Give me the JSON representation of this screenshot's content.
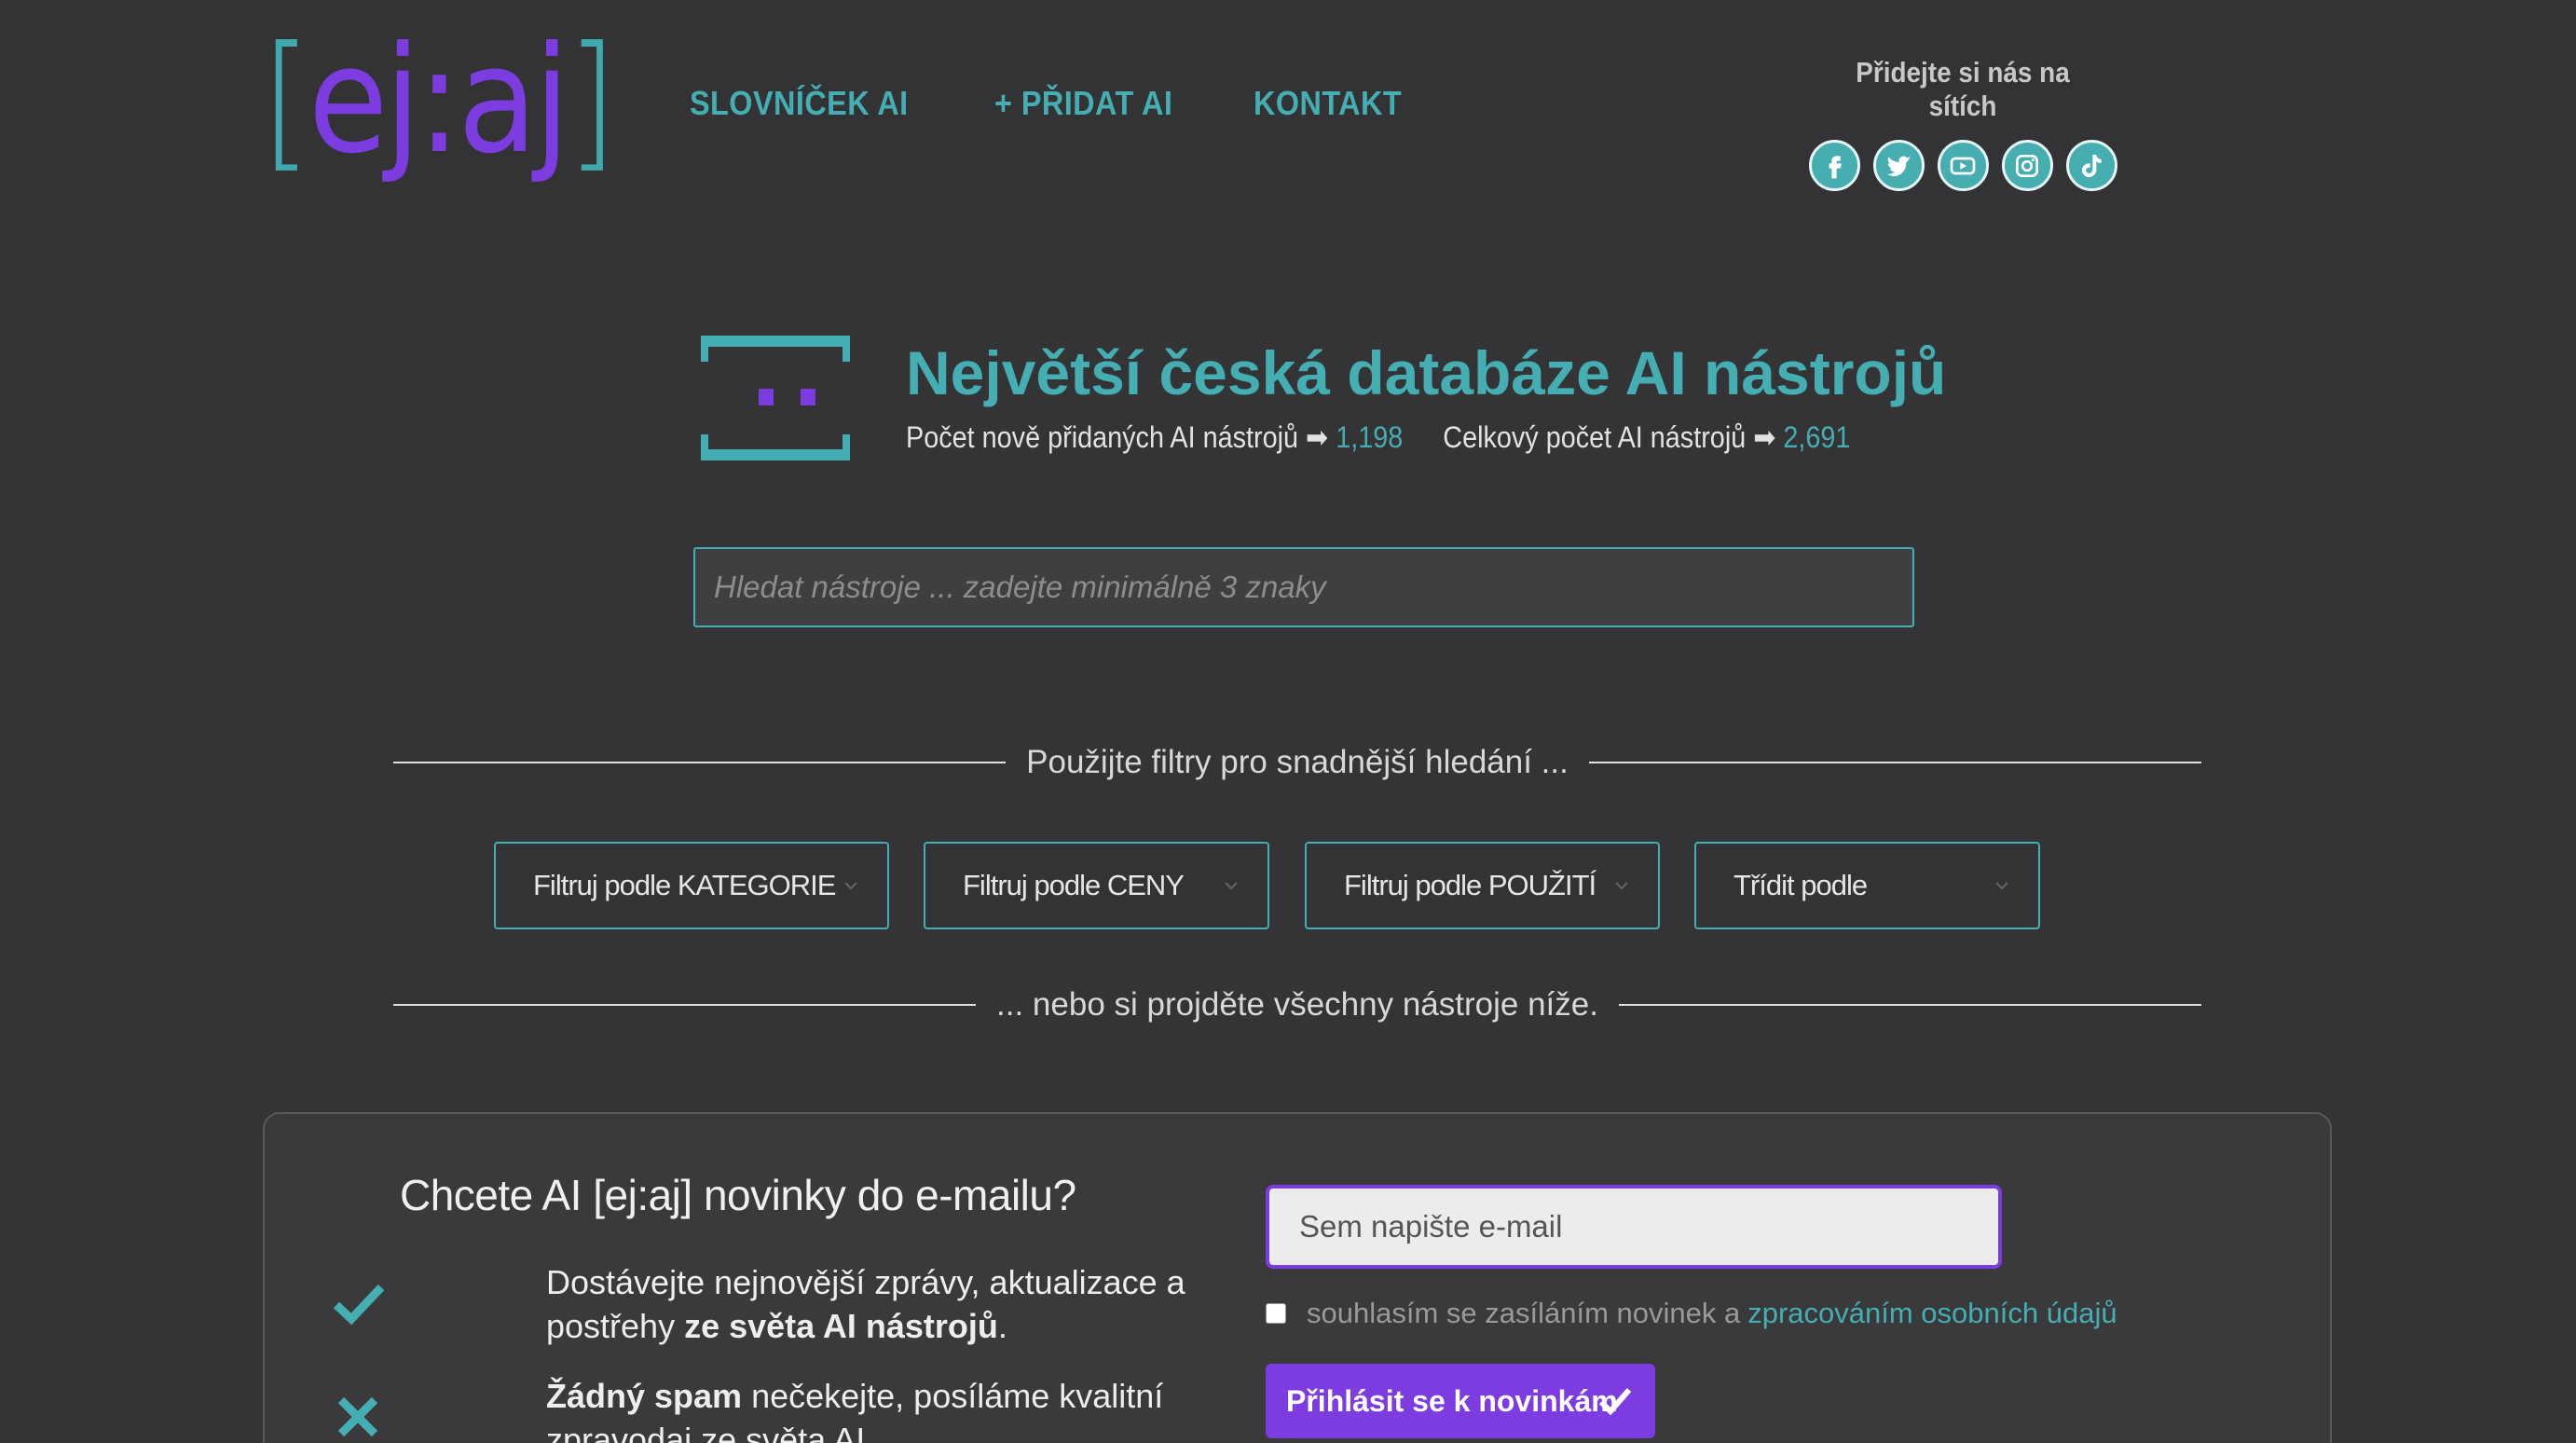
{
  "header": {
    "logo": {
      "open": "[",
      "text": "ej:aj",
      "close": "]"
    },
    "nav": [
      {
        "label": "SLOVNÍČEK AI"
      },
      {
        "label": "+ PŘIDAT AI"
      },
      {
        "label": "KONTAKT"
      }
    ],
    "social": {
      "label": "Přidejte si nás na sítích",
      "icons": [
        "facebook-icon",
        "twitter-icon",
        "youtube-icon",
        "instagram-icon",
        "tiktok-icon"
      ]
    }
  },
  "hero": {
    "title": "Největší česká databáze AI nástrojů",
    "new_label": "Počet nově přidaných AI nástrojů ➡",
    "new_count": "1,198",
    "total_label": "Celkový počet AI nástrojů ➡",
    "total_count": "2,691"
  },
  "search": {
    "placeholder": "Hledat nástroje ... zadejte minimálně 3 znaky"
  },
  "filters": {
    "heading": "Použijte filtry pro snadnější hledání ...",
    "items": [
      {
        "label": "Filtruj podle KATEGORIE"
      },
      {
        "label": "Filtruj podle CENY"
      },
      {
        "label": "Filtruj podle POUŽITÍ"
      },
      {
        "label": "Třídit podle"
      }
    ],
    "footer": "... nebo si projděte všechny nástroje níže."
  },
  "newsletter": {
    "title": "Chcete AI [ej:aj] novinky do e-mailu?",
    "bullet1_prefix": "Dostávejte nejnovější zprávy, aktualizace a postřehy ",
    "bullet1_bold": "ze světa AI nástrojů",
    "bullet1_suffix": ".",
    "bullet2_bold": "Žádný spam",
    "bullet2_rest": " nečekejte, posíláme kvalitní zpravodaj ze světa AI.",
    "email_placeholder": "Sem napište e-mail",
    "consent_text": "souhlasím se zasíláním novinek a",
    "consent_link": "zpracováním osobních údajů",
    "button": "Přihlásit se k novinkám"
  },
  "colors": {
    "teal": "#45aeb3",
    "purple": "#7c3ce0",
    "background": "#343436"
  }
}
